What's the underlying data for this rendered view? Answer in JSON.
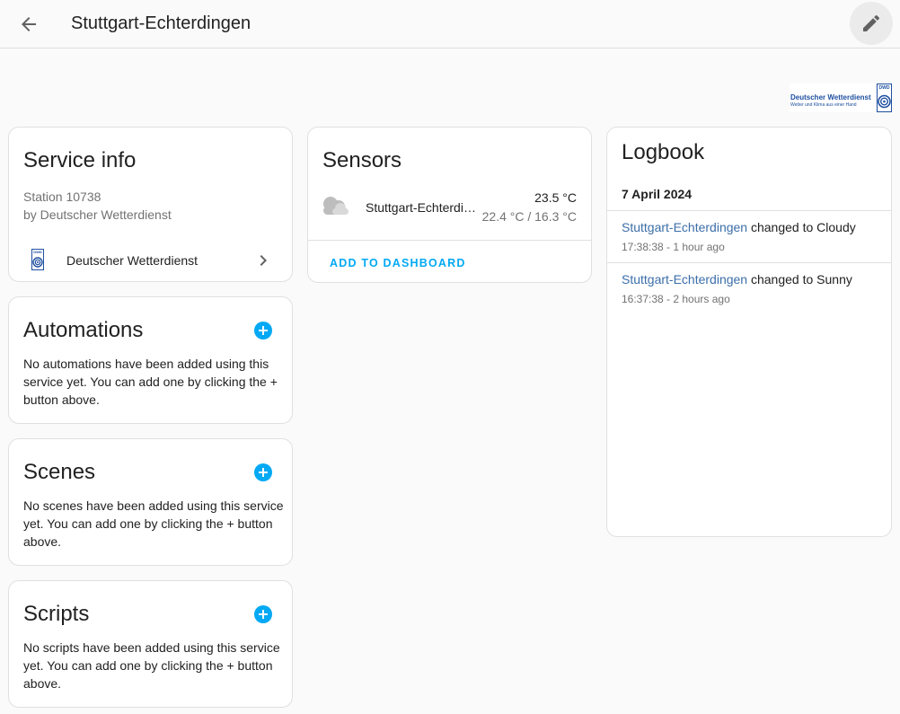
{
  "header": {
    "title": "Stuttgart-Echterdingen",
    "back_icon": "arrow-left-icon",
    "edit_icon": "pencil-icon"
  },
  "brand": {
    "name": "Deutscher Wetterdienst",
    "tagline": "Wetter und Klima aus einer Hand",
    "abbr": "DWD"
  },
  "service_info": {
    "title": "Service info",
    "station": "Station 10738",
    "by": "by Deutscher Wetterdienst",
    "integration_label": "Deutscher Wetterdienst",
    "integration_abbr": "DWD"
  },
  "automations": {
    "title": "Automations",
    "text": "No automations have been added using this service yet. You can add one by clicking the + button above."
  },
  "scenes": {
    "title": "Scenes",
    "text": "No scenes have been added using this service yet. You can add one by clicking the + button above."
  },
  "scripts": {
    "title": "Scripts",
    "text": "No scripts have been added using this service yet. You can add one by clicking the + button above."
  },
  "sensors": {
    "title": "Sensors",
    "entity_name": "Stuttgart-Echterdi…",
    "temperature": "23.5 °C",
    "temp_range": "22.4 °C / 16.3 °C",
    "icon": "cloudy-icon",
    "add_label": "ADD TO DASHBOARD"
  },
  "logbook": {
    "title": "Logbook",
    "date": "7 April 2024",
    "entries": [
      {
        "entity": "Stuttgart-Echterdingen",
        "message": " changed to Cloudy",
        "time": "17:38:38 - 1 hour ago"
      },
      {
        "entity": "Stuttgart-Echterdingen",
        "message": " changed to Sunny",
        "time": "16:37:38 - 2 hours ago"
      }
    ]
  },
  "colors": {
    "accent": "#03a9f4",
    "link": "#3b6ea8",
    "brand_blue": "#1e4fa0"
  }
}
